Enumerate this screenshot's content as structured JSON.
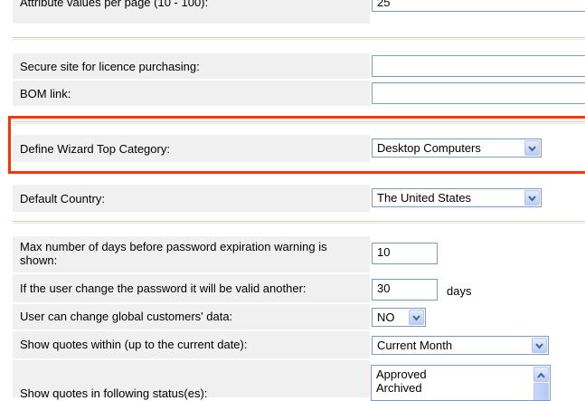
{
  "settings": {
    "attr_per_page": {
      "label": "Attribute values per page (10 - 100):",
      "value": "25"
    },
    "secure_site": {
      "label": "Secure site for licence purchasing:",
      "value": ""
    },
    "bom_link": {
      "label": "BOM link:",
      "value": ""
    },
    "wizard_top_category": {
      "label": "Define Wizard Top Category:",
      "value": "Desktop Computers"
    },
    "default_country": {
      "label": "Default Country:",
      "value": "The United States"
    },
    "password_warning": {
      "label": "Max number of days before password expiration warning is shown:",
      "value": "10"
    },
    "password_validity": {
      "label": "If the user change the password it will be valid another:",
      "value": "30",
      "suffix": "days"
    },
    "global_customers": {
      "label": "User can change global customers' data:",
      "value": "NO"
    },
    "quotes_within": {
      "label": "Show quotes within (up to the current date):",
      "value": "Current Month"
    },
    "quotes_status": {
      "label": "Show quotes in following status(es):",
      "options": [
        "Approved",
        "Archived"
      ]
    }
  },
  "colors": {
    "highlight": "#ff3300",
    "row_bg": "#f0f0f0",
    "input_border": "#7f9db9"
  },
  "icons": {
    "dropdown": "chevron-down-icon",
    "scroll_up": "chevron-up-icon"
  }
}
